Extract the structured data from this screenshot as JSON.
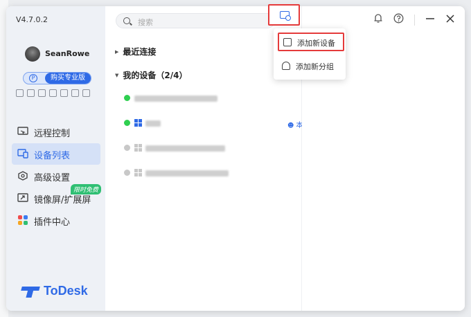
{
  "app": {
    "version": "V4.7.0.2",
    "username": "SeanRowe",
    "pro_button": "购买专业版",
    "pro_p": "P",
    "logo_text": "ToDesk",
    "brand_color": "#2f6ae6"
  },
  "nav": {
    "items": [
      {
        "label": "远程控制",
        "icon": "remote-control-icon"
      },
      {
        "label": "设备列表",
        "icon": "device-list-icon",
        "active": true
      },
      {
        "label": "高级设置",
        "icon": "settings-icon"
      },
      {
        "label": "镜像屏/扩展屏",
        "icon": "mirror-screen-icon"
      },
      {
        "label": "插件中心",
        "icon": "plugin-center-icon"
      }
    ],
    "free_tag": "限时免费"
  },
  "search": {
    "placeholder": "搜索"
  },
  "sections": {
    "recent": "最近连接",
    "my_devices": "我的设备（2/4）"
  },
  "devices": [
    {
      "status": "online",
      "this_device": false
    },
    {
      "status": "online",
      "this_device": true,
      "this_device_label": "本设备"
    },
    {
      "status": "offline",
      "this_device": false
    },
    {
      "status": "offline",
      "this_device": false
    }
  ],
  "menu": {
    "add_device": "添加新设备",
    "add_group": "添加新分组"
  },
  "colors": {
    "online": "#2fcf50",
    "offline": "#c8c8c8",
    "highlight": "#e53a3a"
  }
}
